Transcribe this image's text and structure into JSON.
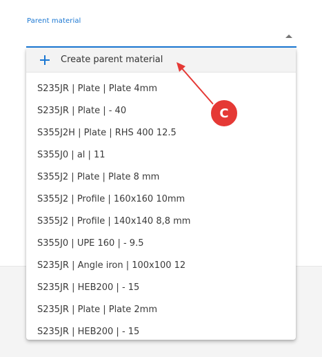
{
  "field": {
    "label": "Parent material",
    "value": ""
  },
  "dropdown": {
    "create_label": "Create parent material",
    "options": [
      "S235JR | Plate | Plate 4mm",
      "S235JR | Plate | - 40",
      "S355J2H | Plate | RHS 400 12.5",
      "S355J0 | al | 11",
      "S355J2 | Plate | Plate 8 mm",
      "S355J2 | Profile | 160x160 10mm",
      "S355J2 | Profile | 140x140 8,8 mm",
      "S355J0 | UPE 160 | - 9.5",
      "S235JR | Angle iron | 100x100 12",
      "S235JR | HEB200 | - 15",
      "S235JR | Plate | Plate 2mm",
      "S235JR | HEB200 | - 15"
    ]
  },
  "annotation": {
    "badge_letter": "C",
    "badge_color": "#e53935",
    "arrow_color": "#e53935"
  },
  "colors": {
    "accent": "#1976d2",
    "create_row_bg": "#f3f3f3",
    "bottom_band_bg": "#f4f4f4"
  },
  "icons": {
    "create": "plus-icon",
    "toggle": "caret-up-icon"
  }
}
